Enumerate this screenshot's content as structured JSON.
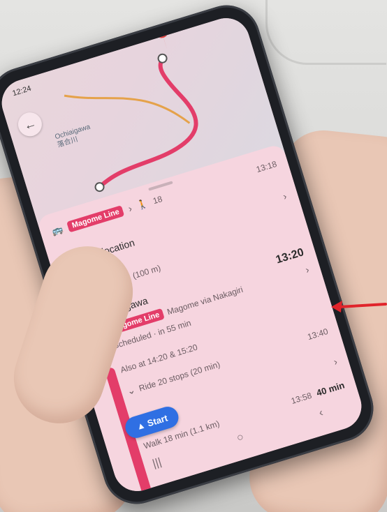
{
  "status": {
    "time": "12:24"
  },
  "map": {
    "place_label": "Ochiaigawa",
    "place_label_jp": "落合川"
  },
  "summary": {
    "line_name": "Magome Line",
    "walk_minutes": "18",
    "arrive_time": "13:18"
  },
  "origin": {
    "label": "Your location"
  },
  "walk_first": {
    "text": "Walk 2 min (100 m)"
  },
  "station": {
    "name": "Konogawa",
    "depart_time": "13:20",
    "line_name": "Magome Line",
    "direction": "Magome via Nakagiri",
    "scheduled": "Scheduled · in 55 min",
    "also_at": "Also at 14:20 & 15:20",
    "ride": "Ride 20 stops (20 min)",
    "ride_arrive": "13:40"
  },
  "destination_stop": {
    "name": "Magome"
  },
  "walk_last": {
    "text": "Walk 18 min (1.1 km)",
    "time": "13:58",
    "duration": "40 min"
  },
  "actions": {
    "start_label": "Start"
  },
  "navbar": {
    "recent": "|||",
    "home": "○",
    "back": "‹"
  },
  "colors": {
    "accent": "#e33d69",
    "start_button": "#2f6fe3",
    "annotation_arrow": "#e0242b"
  }
}
